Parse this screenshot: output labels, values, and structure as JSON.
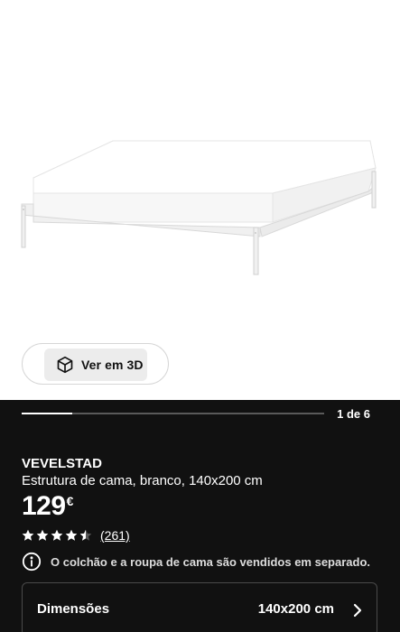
{
  "gallery": {
    "view3d_label": "Ver em 3D",
    "pager": "1 de 6",
    "current_image": 1,
    "total_images": 6
  },
  "product": {
    "name": "VEVELSTAD",
    "description": "Estrutura de cama, branco, 140x200 cm",
    "price": "129",
    "currency": "€",
    "rating": 4.5,
    "max_rating": 5,
    "reviews_label": "(261)"
  },
  "notice": {
    "text": "O colchão e a roupa de cama são vendidos em separado."
  },
  "dimensions": {
    "label": "Dimensões",
    "value": "140x200 cm"
  },
  "icons": {
    "view3d": "cube-icon",
    "info": "info-circle-icon",
    "chevron": "chevron-right-icon",
    "star": "star-icon"
  },
  "colors": {
    "dark_background": "#111111",
    "accent_text": "#ffffff"
  }
}
